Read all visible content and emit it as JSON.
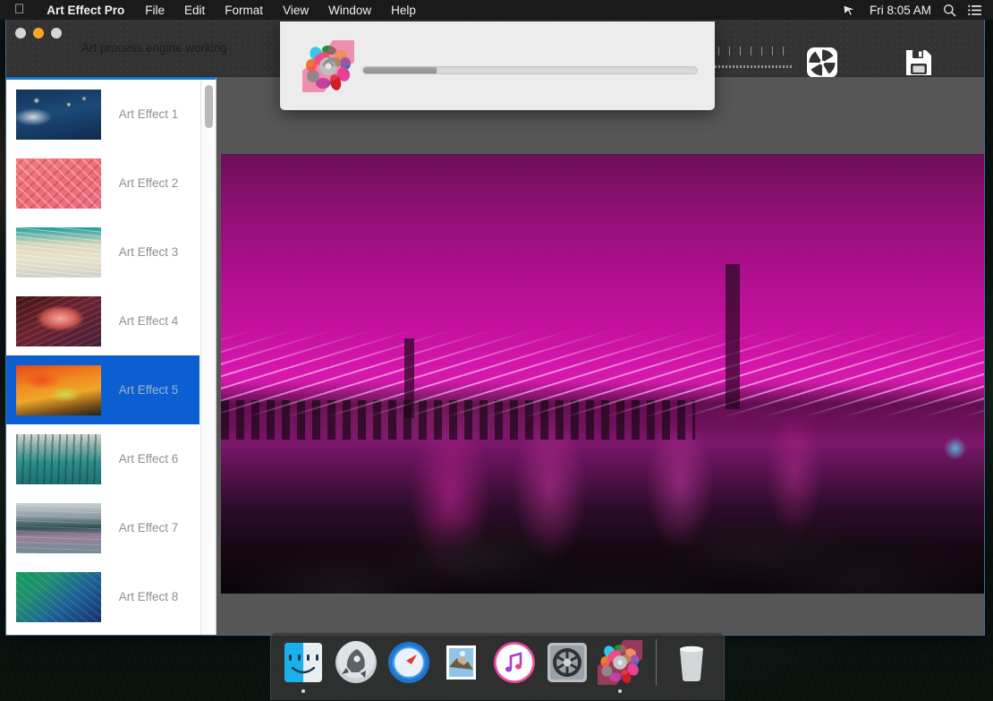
{
  "menubar": {
    "apple_icon": "apple-logo-icon",
    "app_name": "Art Effect Pro",
    "items": [
      "File",
      "Edit",
      "Format",
      "View",
      "Window",
      "Help"
    ],
    "right": {
      "airplay_icon": "airplay-cursor-icon",
      "clock": "Fri 8:05 AM",
      "search_icon": "search-icon",
      "notification_icon": "notification-list-icon"
    }
  },
  "window": {
    "traffic_lights": {
      "close": "close-button",
      "minimize": "minimize-button",
      "maximize": "maximize-button"
    },
    "toolbar": {
      "slider_name": "effect-intensity-slider",
      "shutter_button": "shutter-aperture-button",
      "save_button": "save-button"
    }
  },
  "sidebar": {
    "selected_index": 4,
    "items": [
      {
        "label": "Art Effect 1",
        "thumb": "t1"
      },
      {
        "label": "Art Effect 2",
        "thumb": "t2"
      },
      {
        "label": "Art Effect 3",
        "thumb": "t3"
      },
      {
        "label": "Art Effect 4",
        "thumb": "t4"
      },
      {
        "label": "Art Effect 5",
        "thumb": "t5"
      },
      {
        "label": "Art Effect 6",
        "thumb": "t6"
      },
      {
        "label": "Art Effect 7",
        "thumb": "t7"
      },
      {
        "label": "Art Effect 8",
        "thumb": "t8"
      }
    ]
  },
  "canvas": {
    "photo_description": "bridge-night-photo"
  },
  "dialog": {
    "icon": "art-effect-pro-app-icon",
    "title": "Art process engine working",
    "progress_percent": 22
  },
  "dock": {
    "items": [
      {
        "name": "finder",
        "running": true
      },
      {
        "name": "launchpad",
        "running": false
      },
      {
        "name": "safari",
        "running": false
      },
      {
        "name": "mail",
        "running": false
      },
      {
        "name": "itunes",
        "running": false
      },
      {
        "name": "system-preferences",
        "running": false
      },
      {
        "name": "art-effect-pro",
        "running": true
      }
    ],
    "trash": {
      "name": "trash",
      "running": false
    }
  },
  "colors": {
    "accent_selection": "#0b5fd0",
    "toolbar_bg": "#333333",
    "canvas_bg": "#565656",
    "dialog_bg": "#ececec",
    "menubar_bg": "#1a1a1a"
  }
}
